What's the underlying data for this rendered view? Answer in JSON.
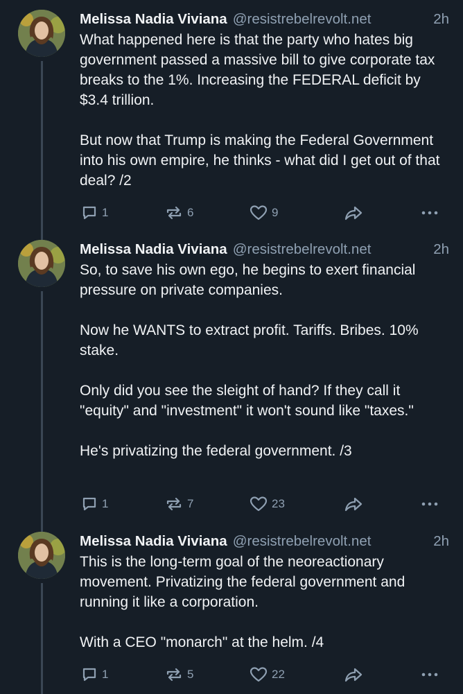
{
  "posts": [
    {
      "author": "Melissa Nadia Viviana",
      "handle": "@resistrebelrevolt.net",
      "time": "2h",
      "paragraphs": [
        "What happened here is that the party who hates big government passed a massive bill to give corporate tax breaks to the 1%. Increasing the FEDERAL deficit by $3.4 trillion.",
        "But now that Trump is making the Federal Government into his own empire, he thinks - what did I get out of that deal? /2"
      ],
      "replies": "1",
      "reposts": "6",
      "likes": "9"
    },
    {
      "author": "Melissa Nadia Viviana",
      "handle": "@resistrebelrevolt.net",
      "time": "2h",
      "paragraphs": [
        "So, to save his own ego, he begins to exert financial pressure on private companies.",
        "Now he WANTS to extract profit. Tariffs. Bribes. 10% stake.",
        "Only did you see the sleight of hand? If they call it \"equity\" and \"investment\" it won't sound like \"taxes.\"",
        "He's privatizing the federal government. /3"
      ],
      "replies": "1",
      "reposts": "7",
      "likes": "23"
    },
    {
      "author": "Melissa Nadia Viviana",
      "handle": "@resistrebelrevolt.net",
      "time": "2h",
      "paragraphs": [
        "This is the long-term goal of the neoreactionary movement. Privatizing the federal government and running it like a corporation.",
        "With a CEO \"monarch\" at the helm. /4"
      ],
      "replies": "1",
      "reposts": "5",
      "likes": "22"
    }
  ],
  "icons": {
    "reply": "reply-icon",
    "repost": "repost-icon",
    "like": "heart-icon",
    "share": "share-icon",
    "more": "more-icon"
  },
  "colors": {
    "background": "#161e27",
    "text": "#f1f3f5",
    "muted": "#8fa0b2",
    "thread_line": "#3a4654"
  }
}
